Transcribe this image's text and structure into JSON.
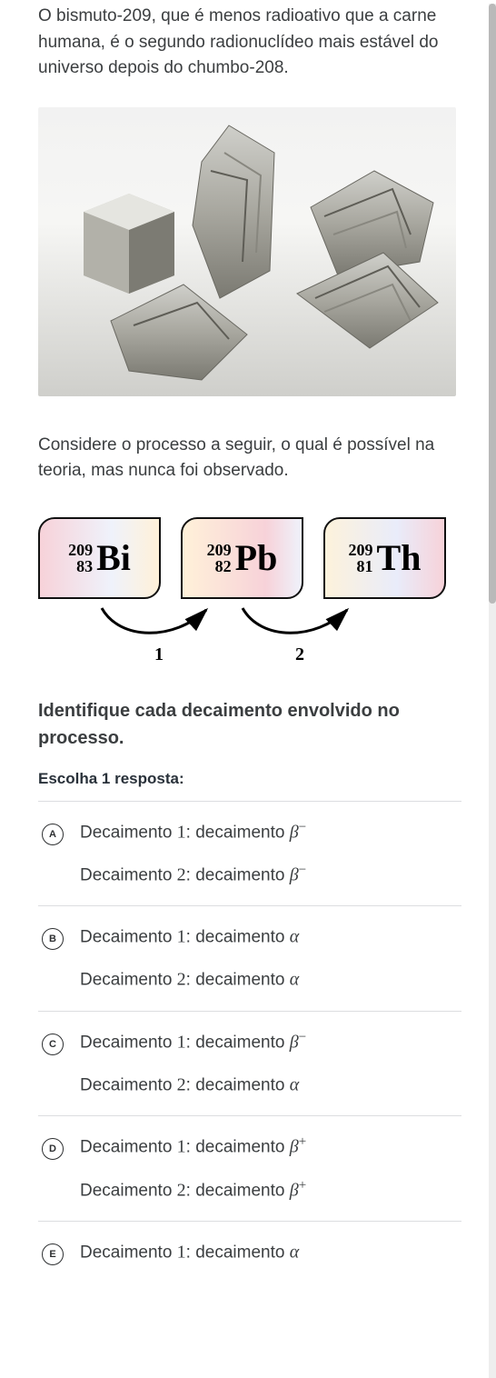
{
  "intro": {
    "p1_a": "O bismuto-",
    "p1_b": "209",
    "p1_c": ", que é menos radioativo que a carne humana, é o segundo radionuclídeo mais estável do universo depois do chumbo-",
    "p1_d": "208",
    "p1_e": "."
  },
  "para2": "Considere o processo a seguir, o qual é possível na teoria, mas nunca foi observado.",
  "tiles": [
    {
      "mass": "209",
      "atomic": "83",
      "sym": "Bi"
    },
    {
      "mass": "209",
      "atomic": "82",
      "sym": "Pb"
    },
    {
      "mass": "209",
      "atomic": "81",
      "sym": "Th"
    }
  ],
  "arrow_labels": {
    "a1": "1",
    "a2": "2"
  },
  "prompt": "Identifique cada decaimento envolvido no processo.",
  "choose_label": "Escolha 1 resposta:",
  "decay_label_prefix": "Decaimento ",
  "decay_value_prefix": ": decaimento ",
  "options": [
    {
      "letter": "A",
      "d1": "β",
      "d1sup": "−",
      "d2": "β",
      "d2sup": "−"
    },
    {
      "letter": "B",
      "d1": "α",
      "d1sup": "",
      "d2": "α",
      "d2sup": ""
    },
    {
      "letter": "C",
      "d1": "β",
      "d1sup": "−",
      "d2": "α",
      "d2sup": ""
    },
    {
      "letter": "D",
      "d1": "β",
      "d1sup": "+",
      "d2": "β",
      "d2sup": "+"
    },
    {
      "letter": "E",
      "d1": "α",
      "d1sup": "",
      "d2": "",
      "d2sup": ""
    }
  ],
  "numbers": {
    "one": "1",
    "two": "2"
  }
}
